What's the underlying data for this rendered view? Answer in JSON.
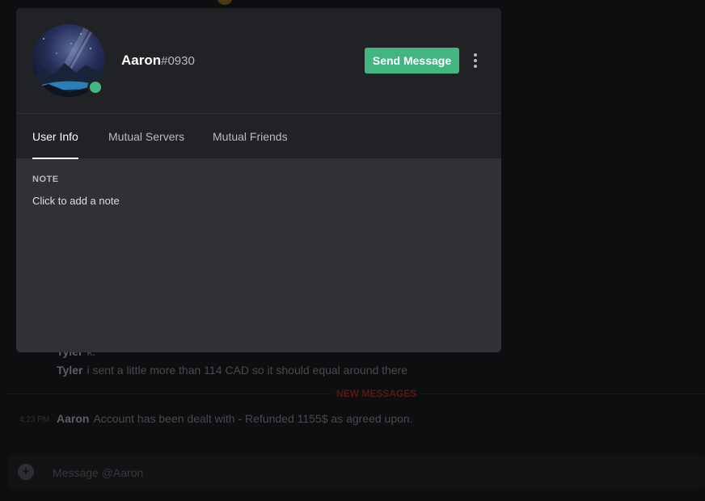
{
  "profile": {
    "username": "Aaron",
    "discriminator": "#0930",
    "status": "online",
    "send_message_label": "Send Message"
  },
  "tabs": [
    {
      "label": "User Info",
      "active": true
    },
    {
      "label": "Mutual Servers",
      "active": false
    },
    {
      "label": "Mutual Friends",
      "active": false
    }
  ],
  "note": {
    "label": "NOTE",
    "placeholder": "Click to add a note"
  },
  "chat": {
    "messages": [
      {
        "author": "Tyler",
        "text": "k."
      },
      {
        "author": "Tyler",
        "text": "i sent a little more than 114 CAD so it should equal around there"
      },
      {
        "author": "Aaron",
        "text": "Account has been dealt with - Refunded 1155$ as agreed upon.",
        "timestamp": "4:23 PM"
      }
    ],
    "new_messages_label": "NEW MESSAGES",
    "input_placeholder": "Message @Aaron"
  },
  "colors": {
    "online": "#43b581",
    "accent_button": "#43b581",
    "modal_header": "#202225",
    "modal_body": "#2f3136",
    "new_messages": "#f04747"
  },
  "icons": {
    "more": "vertical-ellipsis-icon",
    "attach": "plus-circle-icon",
    "status": "online-status-icon"
  }
}
